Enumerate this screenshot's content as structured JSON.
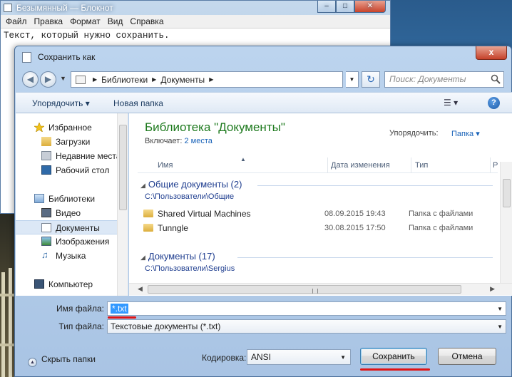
{
  "notepad": {
    "title": "Безымянный — Блокнот",
    "menu": [
      "Файл",
      "Правка",
      "Формат",
      "Вид",
      "Справка"
    ],
    "text": "Текст, который нужно сохранить."
  },
  "dialog": {
    "title": "Сохранить как",
    "close_label": "x",
    "breadcrumb": [
      "Библиотеки",
      "Документы"
    ],
    "search_placeholder": "Поиск: Документы",
    "toolbar": {
      "organize": "Упорядочить ▾",
      "new_folder": "Новая папка"
    },
    "nav": {
      "favorites": "Избранное",
      "downloads": "Загрузки",
      "recent": "Недавние места",
      "desktop": "Рабочий стол",
      "libraries": "Библиотеки",
      "video": "Видео",
      "documents": "Документы",
      "images": "Изображения",
      "music": "Музыка",
      "computer": "Компьютер"
    },
    "library": {
      "title": "Библиотека \"Документы\"",
      "includes_label": "Включает:",
      "includes_link": "2 места",
      "arrange_label": "Упорядочить:",
      "arrange_value": "Папка ▾"
    },
    "columns": {
      "name": "Имя",
      "date": "Дата изменения",
      "type": "Тип",
      "more": "Р"
    },
    "groups": [
      {
        "title": "Общие документы (2)",
        "path": "C:\\Пользователи\\Общие",
        "rows": [
          {
            "name": "Shared Virtual Machines",
            "date": "08.09.2015 19:43",
            "type": "Папка с файлами"
          },
          {
            "name": "Tunngle",
            "date": "30.08.2015 17:50",
            "type": "Папка с файлами"
          }
        ]
      },
      {
        "title": "Документы (17)",
        "path": "C:\\Пользователи\\Sergius",
        "rows": []
      }
    ],
    "filename_label": "Имя файла:",
    "filename_value": "*.txt",
    "filetype_label": "Тип файла:",
    "filetype_value": "Текстовые документы (*.txt)",
    "hide_folders": "Скрыть папки",
    "encoding_label": "Кодировка:",
    "encoding_value": "ANSI",
    "save_button": "Сохранить",
    "cancel_button": "Отмена"
  },
  "colors": {
    "library_title": "#1e7a1e",
    "link": "#1862b8",
    "underline": "#e01414",
    "selection": "#3399ff"
  }
}
